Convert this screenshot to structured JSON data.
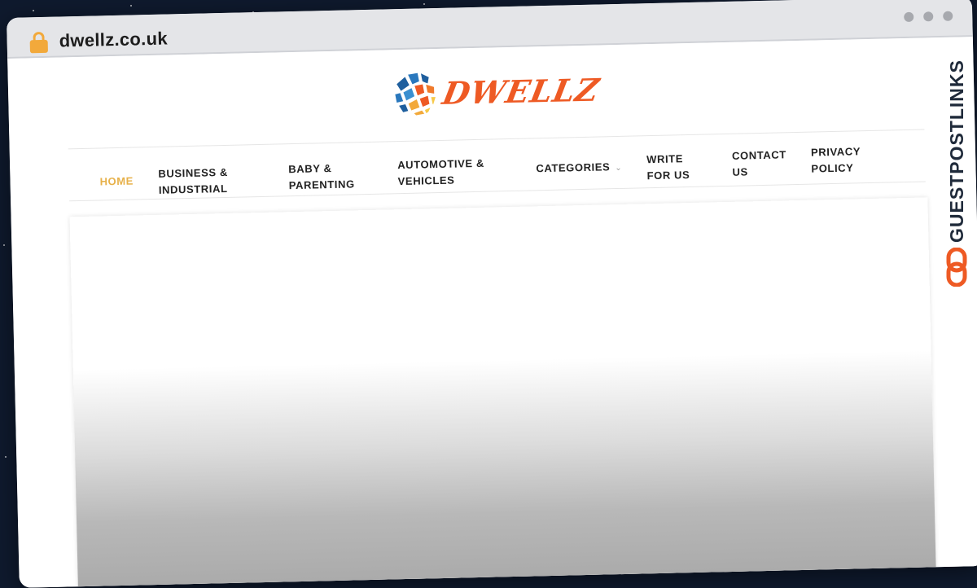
{
  "browser": {
    "url": "dwellz.co.uk"
  },
  "site": {
    "logo_text": "DWELLZ",
    "brand_color": "#ee5a24"
  },
  "nav": {
    "home": "HOME",
    "business_l1": "BUSINESS &",
    "business_l2": "INDUSTRIAL",
    "baby_l1": "BABY &",
    "baby_l2": "PARENTING",
    "auto_l1": "AUTOMOTIVE &",
    "auto_l2": "VEHICLES",
    "categories": "CATEGORIES",
    "write_l1": "WRITE",
    "write_l2": "FOR US",
    "contact_l1": "CONTACT",
    "contact_l2": "US",
    "privacy_l1": "PRIVACY",
    "privacy_l2": "POLICY",
    "active_color": "#e7b14a"
  },
  "watermark": {
    "text": "GUESTPOSTLINKS",
    "icon": "link-icon"
  }
}
